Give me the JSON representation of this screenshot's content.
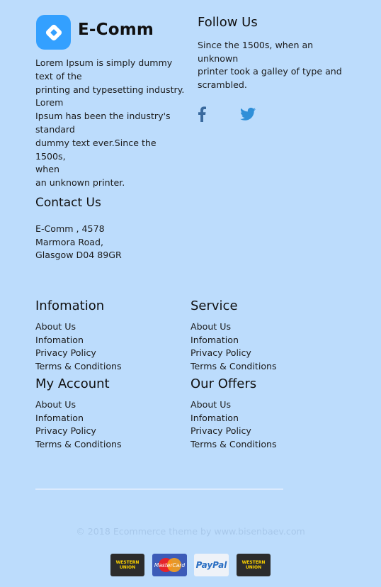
{
  "brand": {
    "name": "E-Comm"
  },
  "about": {
    "lines": [
      "Lorem Ipsum is simply dummy",
      "text of the",
      "printing and typesetting industry.",
      "Lorem",
      "Ipsum has been the industry's",
      "standard",
      "dummy text ever.Since the 1500s,",
      "when",
      "an unknown printer."
    ]
  },
  "follow": {
    "title": "Follow Us",
    "lines": [
      "Since the 1500s, when an",
      "unknown",
      "printer took a galley of type and",
      "scrambled."
    ]
  },
  "contact": {
    "title": "Contact Us",
    "lines": [
      "E-Comm , 4578",
      "Marmora Road,",
      "Glasgow D04 89GR"
    ]
  },
  "columns": [
    {
      "title": "Infomation",
      "links": [
        "About Us",
        "Infomation",
        "Privacy Policy",
        "Terms & Conditions"
      ]
    },
    {
      "title": "Service",
      "links": [
        "About Us",
        "Infomation",
        "Privacy Policy",
        "Terms & Conditions"
      ]
    },
    {
      "title": "My Account",
      "links": [
        "About Us",
        "Infomation",
        "Privacy Policy",
        "Terms & Conditions"
      ]
    },
    {
      "title": "Our Offers",
      "links": [
        "About Us",
        "Infomation",
        "Privacy Policy",
        "Terms & Conditions"
      ]
    }
  ],
  "footer": {
    "copyright": "© 2018 Ecommerce theme by www.bisenbaev.com"
  },
  "payments": [
    {
      "icon": "western-union-icon",
      "text": "WESTERN UNION"
    },
    {
      "icon": "mastercard-icon",
      "text": "MasterCard"
    },
    {
      "icon": "paypal-icon",
      "text": "PayPal"
    },
    {
      "icon": "western-union-icon",
      "text": "WESTERN UNION"
    }
  ],
  "colors": {
    "background": "#bcdcfc",
    "accent": "#33a0ff",
    "social": "#2f8fd8"
  }
}
